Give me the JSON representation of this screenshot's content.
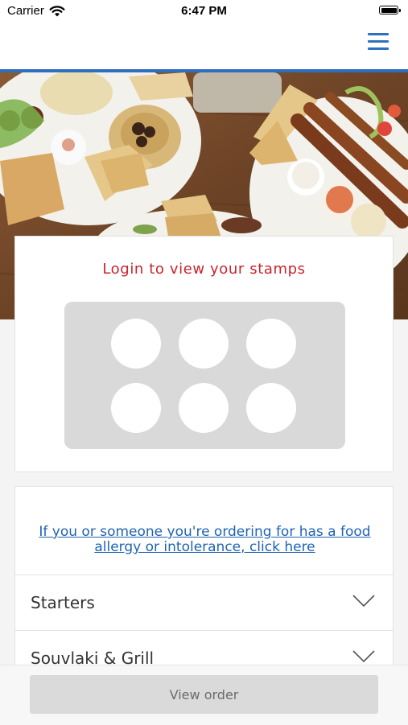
{
  "status_bar": {
    "carrier": "Carrier",
    "time": "6:47 PM"
  },
  "header": {
    "menu_icon": "hamburger-menu-icon",
    "accent_color": "#2f6fc0"
  },
  "stamp_card": {
    "title": "Login to view your stamps",
    "title_color": "#c8252c",
    "stamp_slots": 6
  },
  "menu": {
    "allergy_link": "If you or someone you're ordering for has a food allergy or intolerance, click here",
    "link_color": "#1e63b4",
    "categories": [
      {
        "label": "Starters",
        "icon": "chevron-down-icon"
      },
      {
        "label": "Souvlaki & Grill",
        "icon": "chevron-down-icon"
      }
    ]
  },
  "footer": {
    "view_order_label": "View order"
  }
}
